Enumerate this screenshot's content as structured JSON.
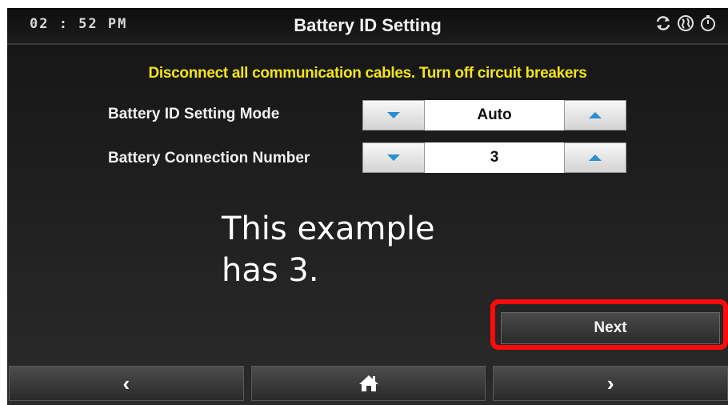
{
  "header": {
    "time": "02 : 52 PM",
    "title": "Battery ID Setting",
    "icons": [
      "sync-icon",
      "globe-icon",
      "power-icon"
    ]
  },
  "warning": "Disconnect all communication cables. Turn off circuit breakers",
  "settings": [
    {
      "label": "Battery ID Setting Mode",
      "value": "Auto"
    },
    {
      "label": "Battery Connection Number",
      "value": "3"
    }
  ],
  "note": {
    "line1": "This example",
    "line2": "has 3."
  },
  "next_label": "Next",
  "footer": {
    "back": "‹",
    "home_icon": "home-icon",
    "forward": "›"
  },
  "colors": {
    "warning": "#f2e31a",
    "arrow": "#2a8fd0",
    "highlight": "#ff0a0a"
  }
}
